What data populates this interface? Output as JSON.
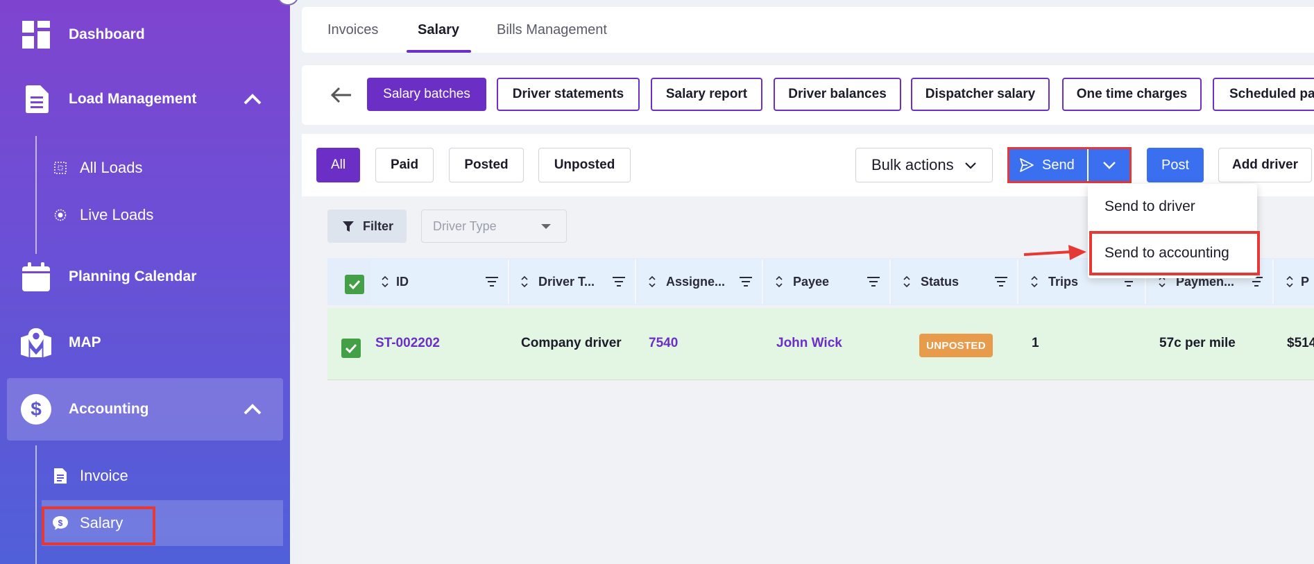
{
  "sidebar": {
    "items": [
      {
        "label": "Dashboard",
        "icon": "dashboard-icon"
      },
      {
        "label": "Load Management",
        "icon": "document-icon"
      },
      {
        "label": "Planning Calendar",
        "icon": "calendar-icon"
      },
      {
        "label": "MAP",
        "icon": "map-icon"
      },
      {
        "label": "Accounting",
        "icon": "dollar-icon"
      }
    ],
    "load_sub": [
      {
        "label": "All Loads",
        "icon": "dotted-square-icon"
      },
      {
        "label": "Live Loads",
        "icon": "live-icon"
      }
    ],
    "accounting_sub": [
      {
        "label": "Invoice",
        "icon": "invoice-icon"
      },
      {
        "label": "Salary",
        "icon": "salary-icon"
      }
    ]
  },
  "tabs": [
    {
      "label": "Invoices"
    },
    {
      "label": "Salary"
    },
    {
      "label": "Bills Management"
    }
  ],
  "subnav": [
    {
      "label": "Salary batches"
    },
    {
      "label": "Driver statements"
    },
    {
      "label": "Salary report"
    },
    {
      "label": "Driver balances"
    },
    {
      "label": "Dispatcher salary"
    },
    {
      "label": "One time charges"
    },
    {
      "label": "Scheduled pa"
    }
  ],
  "status_filters": [
    {
      "label": "All"
    },
    {
      "label": "Paid"
    },
    {
      "label": "Posted"
    },
    {
      "label": "Unposted"
    }
  ],
  "toolbar": {
    "bulk_actions": "Bulk actions",
    "send": "Send",
    "post": "Post",
    "add_driver": "Add driver",
    "filter": "Filter",
    "driver_type_placeholder": "Driver Type"
  },
  "send_menu": [
    {
      "label": "Send to driver"
    },
    {
      "label": "Send to accounting"
    }
  ],
  "table": {
    "columns": [
      "ID",
      "Driver T...",
      "Assigne...",
      "Payee",
      "Status",
      "Trips",
      "Paymen...",
      "P"
    ],
    "rows": [
      {
        "id": "ST-002202",
        "driver_type": "Company driver",
        "assignee": "7540",
        "payee": "John Wick",
        "status": "UNPOSTED",
        "trips": "1",
        "payment": "57c per mile",
        "pay": "$514"
      }
    ]
  },
  "colors": {
    "brand": "#6b2fc6",
    "primary_blue": "#3a6ff0",
    "status_unposted": "#e89b4a",
    "highlight_red": "#e53935",
    "row_selected": "#e3f6e3"
  }
}
